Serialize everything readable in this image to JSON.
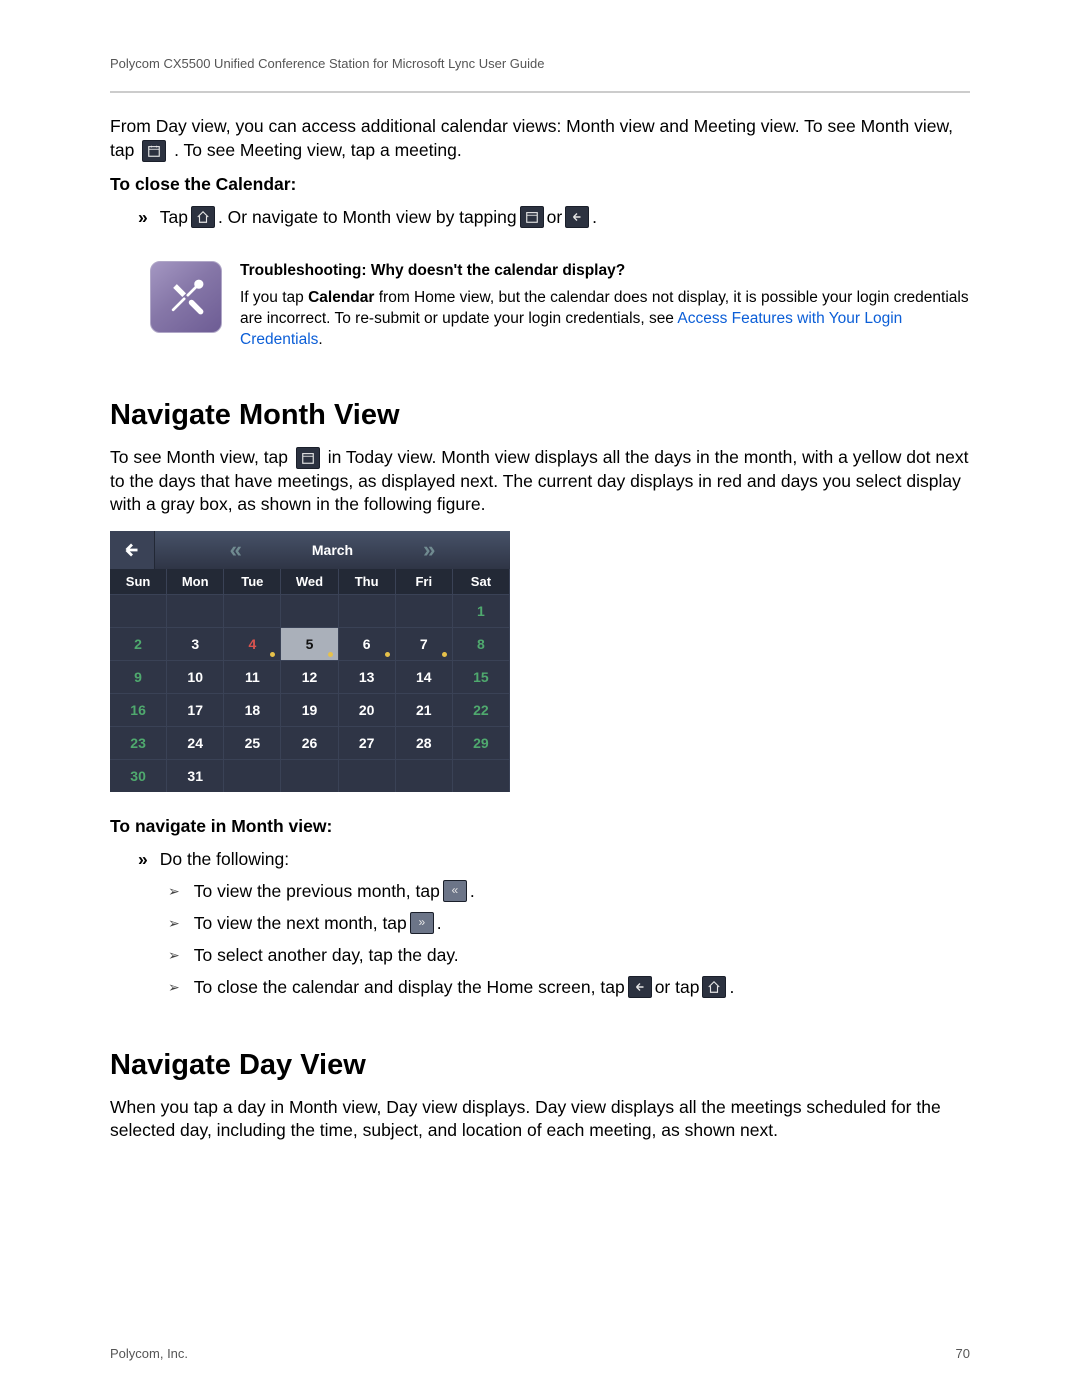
{
  "header": "Polycom CX5500 Unified Conference Station for Microsoft Lync User Guide",
  "intro": {
    "part1": "From Day view, you can access additional calendar views: Month view and Meeting view. To see Month view, tap ",
    "part2": ". To see Meeting view, tap a meeting."
  },
  "close_cal": {
    "title": "To close the Calendar:",
    "line_a": "Tap ",
    "line_b": ". Or navigate to Month view by tapping ",
    "line_c": " or ",
    "line_d": "."
  },
  "trouble": {
    "title": "Troubleshooting: Why doesn't the calendar display?",
    "text_a": "If you tap ",
    "text_bold": "Calendar",
    "text_b": " from Home view, but the calendar does not display, it is possible your login credentials are incorrect. To re-submit or update your login credentials, see ",
    "link": "Access Features with Your Login Credentials",
    "text_c": "."
  },
  "month": {
    "heading": "Navigate Month View",
    "p_a": "To see Month view, tap ",
    "p_b": " in Today view. Month view displays all the days in the month, with a yellow dot next to the days that have meetings, as displayed next. The current day displays in red and days you select display with a gray box, as shown in the following figure."
  },
  "calendar": {
    "month": "March",
    "dow": [
      "Sun",
      "Mon",
      "Tue",
      "Wed",
      "Thu",
      "Fri",
      "Sat"
    ],
    "cells": [
      [
        "",
        "",
        "",
        "",
        "",
        "",
        "1"
      ],
      [
        "2",
        "3",
        "4",
        "5",
        "6",
        "7",
        "8"
      ],
      [
        "9",
        "10",
        "11",
        "12",
        "13",
        "14",
        "15"
      ],
      [
        "16",
        "17",
        "18",
        "19",
        "20",
        "21",
        "22"
      ],
      [
        "23",
        "24",
        "25",
        "26",
        "27",
        "28",
        "29"
      ],
      [
        "30",
        "31",
        "",
        "",
        "",
        "",
        ""
      ]
    ],
    "today": "4",
    "selected": "5",
    "dots": [
      "4",
      "5",
      "6",
      "7"
    ]
  },
  "nav_month": {
    "title": "To navigate in Month view:",
    "line0": "Do the following:",
    "l1a": "To view the previous month, tap ",
    "l1b": ".",
    "l2a": "To view the next month, tap ",
    "l2b": ".",
    "l3": "To select another day, tap the day.",
    "l4a": "To close the calendar and display the Home screen, tap ",
    "l4b": " or tap ",
    "l4c": "."
  },
  "day": {
    "heading": "Navigate Day View",
    "p": "When you tap a day in Month view, Day view displays. Day view displays all the meetings scheduled for the selected day, including the time, subject, and location of each meeting, as shown next."
  },
  "footer": {
    "left": "Polycom, Inc.",
    "right": "70"
  }
}
